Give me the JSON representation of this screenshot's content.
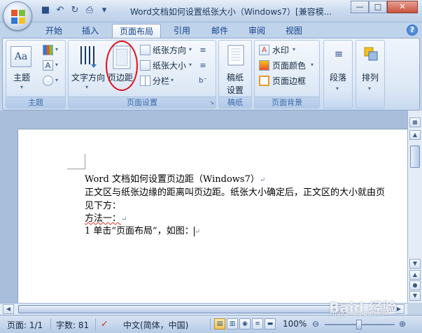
{
  "window": {
    "title": "Word文档如何设置纸张大小（Windows7）[兼容模...",
    "buttons": {
      "minimize": "—",
      "maximize": "□",
      "close": "✕"
    }
  },
  "quick_access": {
    "save": "save-icon",
    "undo": "undo-icon",
    "redo": "redo-icon",
    "print": "print-icon",
    "more": "▾"
  },
  "tabs": [
    {
      "label": "开始",
      "active": false
    },
    {
      "label": "插入",
      "active": false
    },
    {
      "label": "页面布局",
      "active": true
    },
    {
      "label": "引用",
      "active": false
    },
    {
      "label": "邮件",
      "active": false
    },
    {
      "label": "审阅",
      "active": false
    },
    {
      "label": "视图",
      "active": false
    }
  ],
  "ribbon": {
    "groups": {
      "theme": {
        "label": "主题",
        "theme_button": "主题"
      },
      "page_setup": {
        "label": "页面设置",
        "text_direction": "文字方向",
        "margins": "页边距",
        "orientation": "纸张方向",
        "size": "纸张大小",
        "columns": "分栏"
      },
      "draft": {
        "label": "稿纸",
        "draft_button": "稿纸\n设置",
        "line1": "稿纸",
        "line2": "设置"
      },
      "page_background": {
        "label": "页面背景",
        "watermark": "水印",
        "page_color": "页面颜色",
        "page_border": "页面边框"
      },
      "paragraph": {
        "label": "段落"
      },
      "arrange": {
        "label": "排列"
      }
    },
    "highlight_color": "#e0141e"
  },
  "document": {
    "lines": [
      "Word 文档如何设置页边距（Windows7）",
      "正文区与纸张边缘的距离叫页边距。纸张大小确定后，正文区的大小就由页",
      "见下方：",
      "方法一：",
      "1 单击“页面布局”，如图："
    ],
    "paragraph_mark": "↵"
  },
  "status_bar": {
    "page": "页面: 1/1",
    "word_count": "字数: 81",
    "language": "中文(简体，中国)",
    "zoom": "100%"
  },
  "watermark": {
    "text": "Baid 经验",
    "url": "jingyan.baidu.com"
  }
}
